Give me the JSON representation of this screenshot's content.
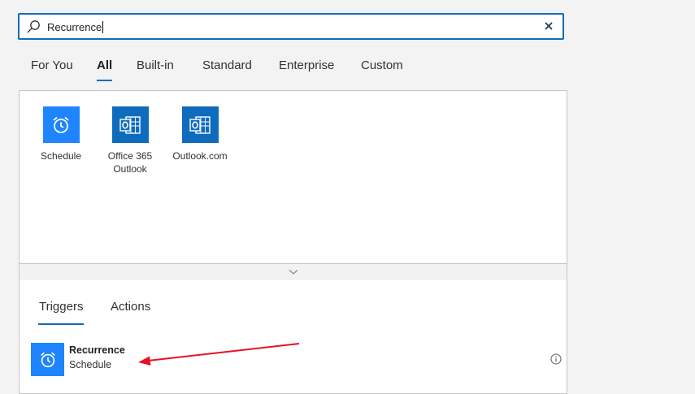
{
  "search": {
    "value": "Recurrence"
  },
  "tabs": [
    {
      "label": "For You"
    },
    {
      "label": "All"
    },
    {
      "label": "Built-in"
    },
    {
      "label": "Standard"
    },
    {
      "label": "Enterprise"
    },
    {
      "label": "Custom"
    }
  ],
  "active_tab": "All",
  "connectors": [
    {
      "label": "Schedule",
      "icon": "alarm-clock-icon"
    },
    {
      "label": "Office 365 Outlook",
      "icon": "outlook-icon"
    },
    {
      "label": "Outlook.com",
      "icon": "outlook-icon"
    }
  ],
  "subtabs": [
    {
      "label": "Triggers"
    },
    {
      "label": "Actions"
    }
  ],
  "active_subtab": "Triggers",
  "operations": [
    {
      "name": "Recurrence",
      "connector": "Schedule",
      "icon": "alarm-clock-icon"
    }
  ],
  "colors": {
    "accent": "#0f6cbd",
    "schedule_tile": "#1f85ff",
    "outlook_tile": "#0f6cbd",
    "annotation_arrow": "#e81123"
  }
}
